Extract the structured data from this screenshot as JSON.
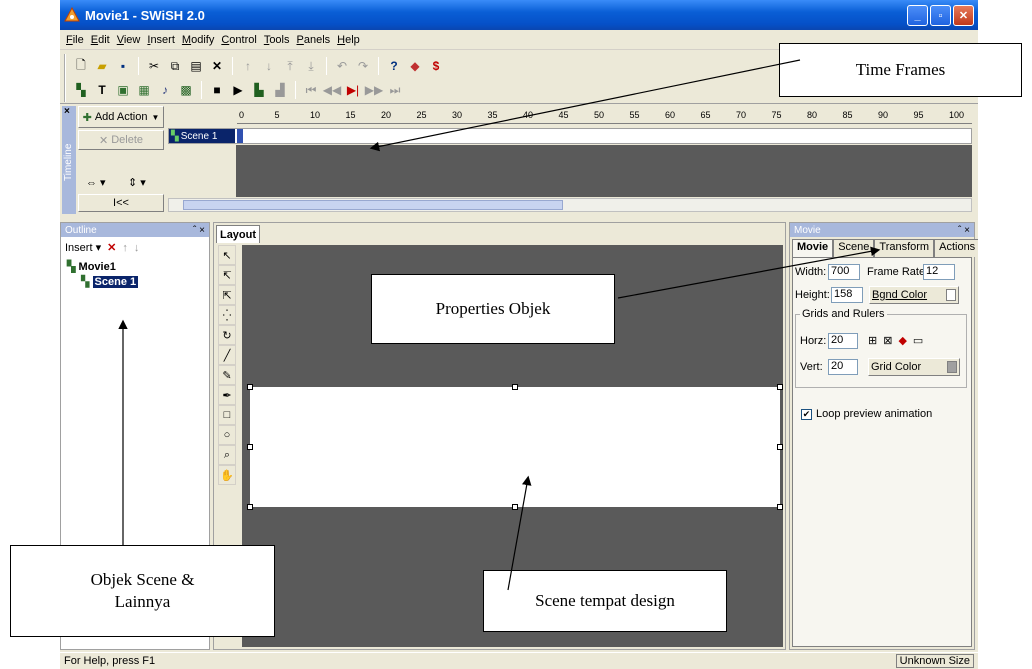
{
  "window": {
    "title": "Movie1 - SWiSH 2.0",
    "min": "_",
    "max": "▫",
    "close": "✕"
  },
  "menu": [
    "File",
    "Edit",
    "View",
    "Insert",
    "Modify",
    "Control",
    "Tools",
    "Panels",
    "Help"
  ],
  "timeline": {
    "side_label": "Timeline",
    "add_action": "Add Action",
    "delete": "Delete",
    "rewind": "I<<",
    "scene_name": "Scene 1",
    "ruler": [
      "0",
      "5",
      "10",
      "15",
      "20",
      "25",
      "30",
      "35",
      "40",
      "45",
      "50",
      "55",
      "60",
      "65",
      "70",
      "75",
      "80",
      "85",
      "90",
      "95",
      "100"
    ]
  },
  "outline": {
    "title": "Outline",
    "insert": "Insert",
    "items": [
      "Movie1",
      "Scene 1"
    ]
  },
  "layout": {
    "tab": "Layout"
  },
  "properties": {
    "title": "Movie",
    "tabs": [
      "Movie",
      "Scene",
      "Transform",
      "Actions"
    ],
    "width_label": "Width:",
    "width_value": "700",
    "frame_rate_label": "Frame Rate:",
    "frame_rate_value": "12",
    "height_label": "Height:",
    "height_value": "158",
    "bgnd_color": "Bgnd Color",
    "grids_label": "Grids and Rulers",
    "horz_label": "Horz:",
    "horz_value": "20",
    "vert_label": "Vert:",
    "vert_value": "20",
    "grid_color": "Grid Color",
    "loop_label": "Loop preview animation"
  },
  "status": {
    "left": "For Help, press F1",
    "right": "Unknown Size"
  },
  "annotations": {
    "time_frames": "Time Frames",
    "properties": "Properties Objek",
    "objects_line1": "Objek Scene &",
    "objects_line2": "Lainnya",
    "scene": "Scene tempat design"
  }
}
